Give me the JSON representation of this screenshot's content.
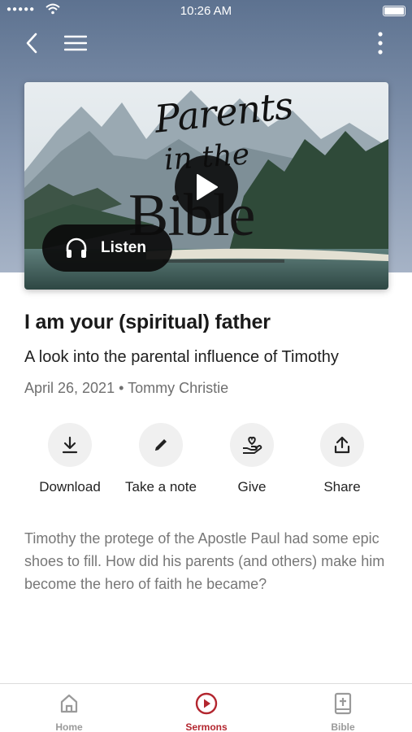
{
  "status_bar": {
    "time": "10:26 AM",
    "signal": "●●●●●"
  },
  "header": {
    "back_icon": "chevron-left-icon",
    "menu_icon": "hamburger-menu-icon",
    "more_icon": "vertical-dots-icon"
  },
  "hero": {
    "artwork_title_line1": "Parents",
    "artwork_title_line2": "in the",
    "artwork_title_line3": "Bible",
    "play_icon": "play-icon",
    "listen_label": "Listen",
    "listen_icon": "headphones-icon"
  },
  "sermon": {
    "title": "I am your (spiritual) father",
    "subtitle": "A look into the parental influence of Timothy",
    "date": "April 26, 2021",
    "separator": "•",
    "speaker": "Tommy Christie",
    "description": "Timothy the protege of the Apostle Paul had some epic shoes to fill. How did his parents (and others) make him become the hero of faith he became?"
  },
  "actions": [
    {
      "label": "Download",
      "icon": "download-icon"
    },
    {
      "label": "Take a note",
      "icon": "pencil-icon"
    },
    {
      "label": "Give",
      "icon": "giving-hand-icon"
    },
    {
      "label": "Share",
      "icon": "share-icon"
    }
  ],
  "tabs": [
    {
      "label": "Home",
      "icon": "home-icon",
      "active": false
    },
    {
      "label": "Sermons",
      "icon": "play-circle-icon",
      "active": true
    },
    {
      "label": "Bible",
      "icon": "bible-icon",
      "active": false
    }
  ],
  "colors": {
    "accent": "#b3262f",
    "header_bg": "#6f809b",
    "inactive_tab": "#9a9a9a"
  }
}
